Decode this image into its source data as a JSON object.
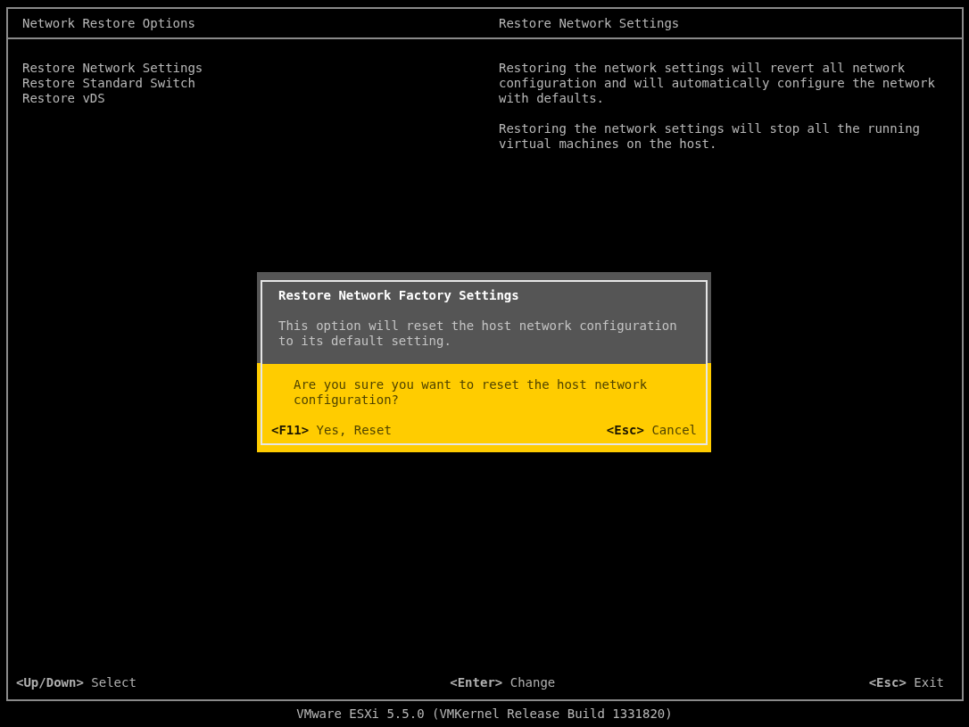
{
  "header": {
    "left_title": "Network Restore Options",
    "right_title": "Restore Network Settings"
  },
  "menu": {
    "items": [
      {
        "label": "Restore Network Settings"
      },
      {
        "label": "Restore Standard Switch"
      },
      {
        "label": "Restore vDS"
      }
    ]
  },
  "description": [
    "Restoring the network settings will revert all network configuration and will automatically configure the network with defaults.",
    "Restoring the network settings will stop all the running virtual machines on the host."
  ],
  "dialog": {
    "title": "Restore Network Factory Settings",
    "message": "This option will reset the host network configuration to its default setting.",
    "question": "Are you sure you want to reset the host network configuration?",
    "actions": [
      {
        "key": "<F11>",
        "label": "Yes, Reset"
      },
      {
        "key": "<Esc>",
        "label": "Cancel"
      }
    ]
  },
  "footer": {
    "hints": [
      {
        "key": "<Up/Down>",
        "label": "Select"
      },
      {
        "key": "<Enter>",
        "label": "Change"
      },
      {
        "key": "<Esc>",
        "label": "Exit"
      }
    ]
  },
  "version": "VMware ESXi 5.5.0 (VMKernel Release Build 1331820)"
}
